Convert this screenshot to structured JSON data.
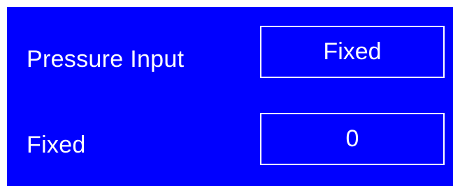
{
  "settings": {
    "rows": [
      {
        "label": "Pressure Input",
        "value": "Fixed"
      },
      {
        "label": "Fixed",
        "value": "0"
      }
    ]
  },
  "colors": {
    "background": "#0000ff",
    "foreground": "#ffffff"
  }
}
